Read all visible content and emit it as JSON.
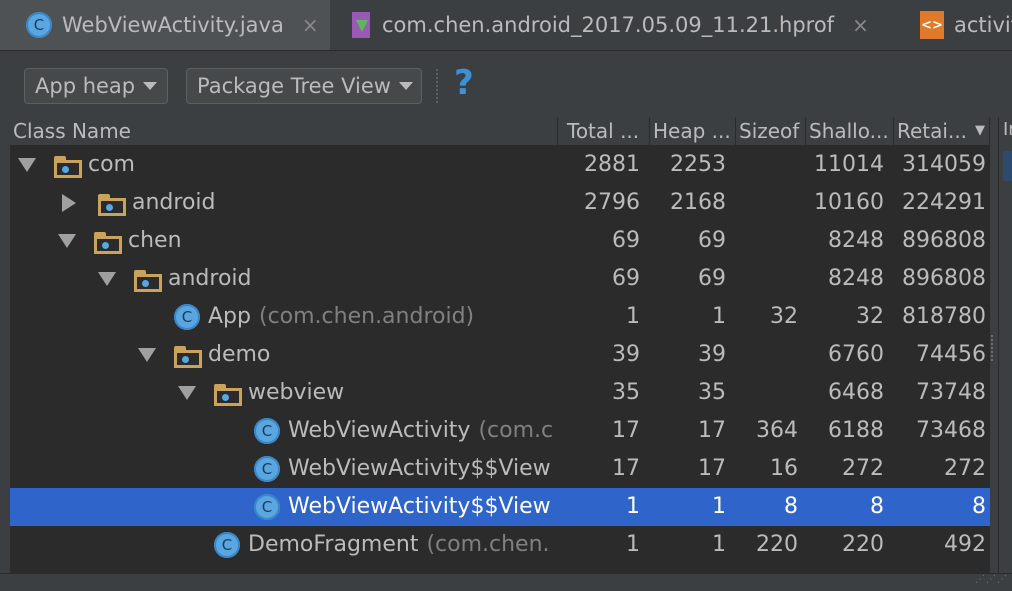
{
  "tabs": [
    {
      "label": "WebViewActivity.java",
      "icon": "class-icon"
    },
    {
      "label": "com.chen.android_2017.05.09_11.21.hprof",
      "icon": "hprof-file-icon"
    },
    {
      "label": "activit",
      "icon": "xml-file-icon"
    }
  ],
  "tab_close_glyph": "×",
  "toolbar": {
    "heap_select": "App heap",
    "view_select": "Package Tree View",
    "help_glyph": "?"
  },
  "columns": [
    "Class Name",
    "Total ...",
    "Heap ...",
    "Sizeof",
    "Shallo...",
    "Retai..."
  ],
  "sort_indicator": "▼",
  "rows": [
    {
      "name": "com",
      "pkg": "",
      "type": "folder",
      "expand": "down",
      "depth": 0,
      "total": "2881",
      "heap": "2253",
      "sizeof": "",
      "shallow": "11014",
      "retained": "314059"
    },
    {
      "name": "android",
      "pkg": "",
      "type": "folder",
      "expand": "right",
      "depth": 1,
      "total": "2796",
      "heap": "2168",
      "sizeof": "",
      "shallow": "10160",
      "retained": "224291"
    },
    {
      "name": "chen",
      "pkg": "",
      "type": "folder",
      "expand": "down",
      "depth": 1,
      "total": "69",
      "heap": "69",
      "sizeof": "",
      "shallow": "8248",
      "retained": "896808"
    },
    {
      "name": "android",
      "pkg": "",
      "type": "folder",
      "expand": "down",
      "depth": 2,
      "total": "69",
      "heap": "69",
      "sizeof": "",
      "shallow": "8248",
      "retained": "896808"
    },
    {
      "name": "App",
      "pkg": "(com.chen.android)",
      "type": "class",
      "expand": "none",
      "depth": 3,
      "total": "1",
      "heap": "1",
      "sizeof": "32",
      "shallow": "32",
      "retained": "818780"
    },
    {
      "name": "demo",
      "pkg": "",
      "type": "folder",
      "expand": "down",
      "depth": 3,
      "total": "39",
      "heap": "39",
      "sizeof": "",
      "shallow": "6760",
      "retained": "74456"
    },
    {
      "name": "webview",
      "pkg": "",
      "type": "folder",
      "expand": "down",
      "depth": 4,
      "total": "35",
      "heap": "35",
      "sizeof": "",
      "shallow": "6468",
      "retained": "73748"
    },
    {
      "name": "WebViewActivity",
      "pkg": "(com.c",
      "type": "class",
      "expand": "none",
      "depth": 5,
      "total": "17",
      "heap": "17",
      "sizeof": "364",
      "shallow": "6188",
      "retained": "73468"
    },
    {
      "name": "WebViewActivity$$View",
      "pkg": "",
      "type": "class",
      "expand": "none",
      "depth": 5,
      "total": "17",
      "heap": "17",
      "sizeof": "16",
      "shallow": "272",
      "retained": "272"
    },
    {
      "name": "WebViewActivity$$View",
      "pkg": "",
      "type": "class",
      "expand": "none",
      "depth": 5,
      "total": "1",
      "heap": "1",
      "sizeof": "8",
      "shallow": "8",
      "retained": "8",
      "selected": true
    },
    {
      "name": "DemoFragment",
      "pkg": "(com.chen.",
      "type": "class",
      "expand": "none",
      "depth": 4,
      "total": "1",
      "heap": "1",
      "sizeof": "220",
      "shallow": "220",
      "retained": "492"
    }
  ],
  "right_panel_label": "Ir",
  "colors": {
    "selection": "#2f65ca",
    "background": "#2b2b2b",
    "class_icon": "#5aa6e1",
    "folder": "#c9a35c"
  }
}
